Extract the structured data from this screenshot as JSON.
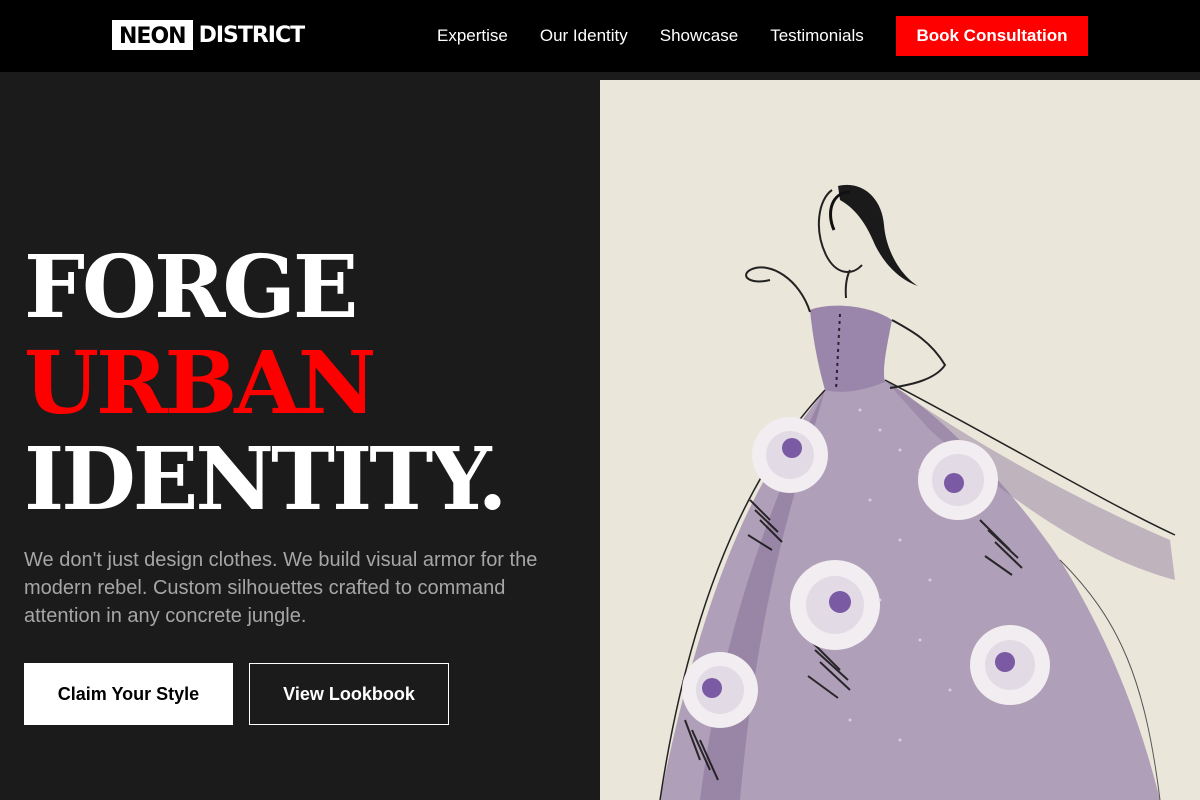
{
  "nav": {
    "logo_box": "NEON",
    "logo_rest": "DISTRICT",
    "links": [
      "Expertise",
      "Our Identity",
      "Showcase",
      "Testimonials"
    ],
    "cta": "Book Consultation"
  },
  "hero": {
    "line1": "FORGE",
    "line2": "URBAN",
    "line3": "IDENTITY.",
    "lede": "We don't just design clothes. We build visual armor for the modern rebel. Custom silhouettes crafted to command attention in any concrete jungle.",
    "primary_button": "Claim Your Style",
    "secondary_button": "View Lookbook"
  },
  "colors": {
    "accent": "#ff0000",
    "background": "#1b1b1b",
    "nav_background": "#000000",
    "image_panel": "#ebe6da",
    "gown": "#9f8bb0"
  },
  "image": {
    "icon": "fashion-sketch-illustration"
  }
}
